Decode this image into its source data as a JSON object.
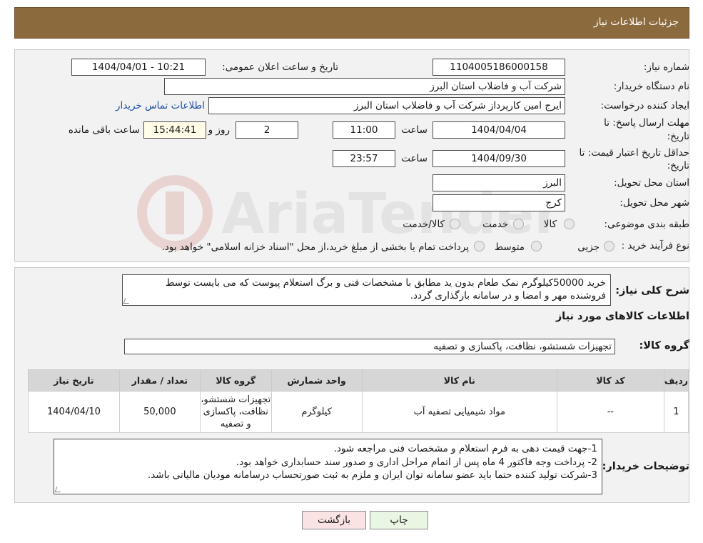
{
  "header": {
    "title": "جزئیات اطلاعات نیاز"
  },
  "form": {
    "need_number_label": "شماره نیاز:",
    "need_number": "1104005186000158",
    "announce_label": "تاریخ و ساعت اعلان عمومی:",
    "announce_value": "1404/04/01 - 10:21",
    "buyer_label": "نام دستگاه خریدار:",
    "buyer_value": "شرکت آب و فاضلاب استان البرز",
    "creator_label": "ایجاد کننده درخواست:",
    "creator_value": "ایرج امین کارپرداز شرکت آب و فاضلاب استان البرز",
    "contact_link": "اطلاعات تماس خریدار",
    "deadline_label_line1": "مهلت ارسال پاسخ: تا",
    "deadline_label_line2": "تاریخ:",
    "deadline_date": "1404/04/04",
    "time_label": "ساعت",
    "deadline_time": "11:00",
    "days_value": "2",
    "days_label": "روز و",
    "remaining_time": "15:44:41",
    "remaining_label": "ساعت باقی مانده",
    "price_valid_label_line1": "حداقل تاریخ اعتبار قیمت: تا",
    "price_valid_label_line2": "تاریخ:",
    "price_valid_date": "1404/09/30",
    "price_valid_time": "23:57",
    "province_label": "استان محل تحویل:",
    "province_value": "البرز",
    "city_label": "شهر محل تحویل:",
    "city_value": "کرج",
    "category_label": "طبقه بندی موضوعی:",
    "category_options": [
      "کالا",
      "خدمت",
      "کالا/خدمت"
    ],
    "process_label": "نوع فرآیند خرید :",
    "process_options": [
      "جزیی",
      "متوسط"
    ],
    "process_note": "پرداخت تمام یا بخشی از مبلغ خرید،از محل \"اسناد خزانه اسلامی\" خواهد بود."
  },
  "description": {
    "label": "شرح کلی نیاز:",
    "text": "خرید 50000کیلوگرم نمک طعام بدون ید مطابق با مشخصات فنی و برگ استعلام پیوست که می بایست توسط فروشنده مهر و امضا و در سامانه بارگذاری گردد."
  },
  "goods": {
    "section_title": "اطلاعات کالاهای مورد نیاز",
    "group_label": "گروه کالا:",
    "group_value": "تجهیزات شستشو، نظافت، پاکسازی و تصفیه",
    "columns": [
      "ردیف",
      "کد کالا",
      "نام کالا",
      "واحد شمارش",
      "گروه کالا",
      "تعداد / مقدار",
      "تاریخ نیاز"
    ],
    "rows": [
      [
        "1",
        "--",
        "مواد شیمیایی تصفیه آب",
        "کیلوگرم",
        "تجهیزات شستشو، نظافت، پاکسازی و تصفیه",
        "50,000",
        "1404/04/10"
      ]
    ]
  },
  "notes": {
    "label": "توضیحات خریدار:",
    "lines": [
      "1-جهت قیمت دهی به فرم استعلام و مشخصات فنی مراجعه شود.",
      "2- پرداخت وجه فاکتور 4 ماه پس از اتمام مراحل اداری و صدور سند حسابداری خواهد بود.",
      "3-شرکت تولید کننده حتما باید عضو سامانه توان ایران و ملزم به ثبت صورتحساب درسامانه مودیان مالیاتی باشد."
    ]
  },
  "buttons": {
    "print": "چاپ",
    "back": "بازگشت"
  },
  "watermark_text": "AriaTender.neT"
}
